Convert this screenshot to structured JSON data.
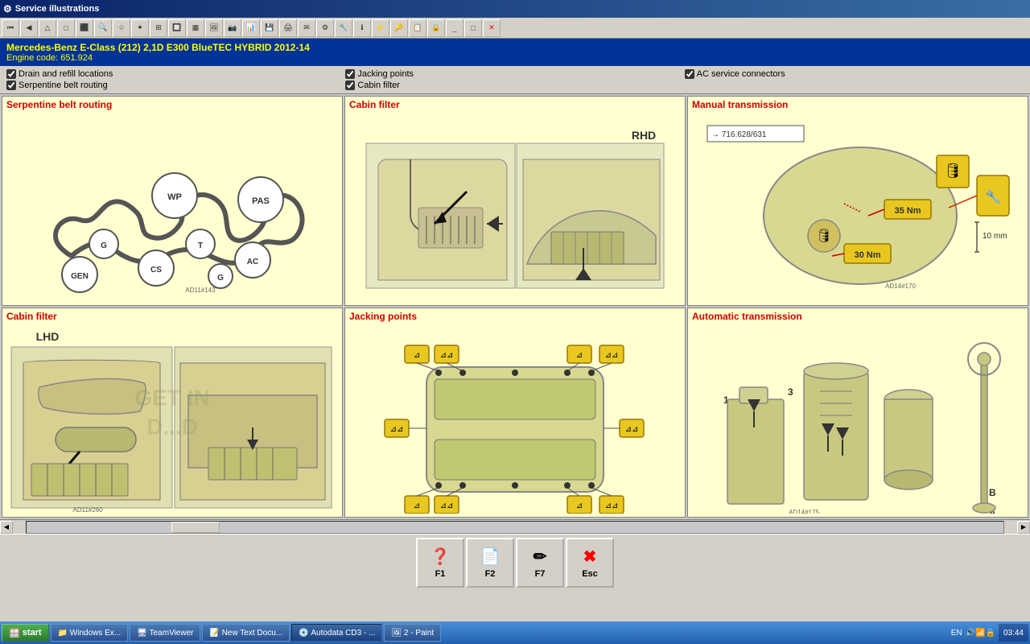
{
  "titlebar": {
    "icon": "⚙",
    "title": "Service illustrations"
  },
  "header": {
    "car_title": "Mercedes-Benz  E-Class (212) 2,1D E300 BlueTEC HYBRID 2012-14",
    "engine_code": "Engine code: 651.924"
  },
  "checkboxes": {
    "col1": [
      {
        "label": "Drain and refill locations",
        "checked": true
      },
      {
        "label": "Serpentine belt routing",
        "checked": true
      }
    ],
    "col2": [
      {
        "label": "Jacking points",
        "checked": true
      },
      {
        "label": "Cabin filter",
        "checked": true
      }
    ],
    "col3": [
      {
        "label": "AC service connectors",
        "checked": true
      }
    ]
  },
  "panels": [
    {
      "id": "serpentine",
      "title": "Serpentine belt routing",
      "row": 1,
      "col": 1
    },
    {
      "id": "cabin-filter-rhd",
      "title": "Cabin filter",
      "row": 1,
      "col": 2
    },
    {
      "id": "manual-transmission",
      "title": "Manual transmission",
      "row": 1,
      "col": 3
    },
    {
      "id": "cabin-filter-lhd",
      "title": "Cabin filter",
      "row": 2,
      "col": 1
    },
    {
      "id": "jacking-points",
      "title": "Jacking points",
      "row": 2,
      "col": 2
    },
    {
      "id": "automatic-transmission",
      "title": "Automatic transmission",
      "row": 2,
      "col": 3
    }
  ],
  "function_buttons": [
    {
      "key": "F1",
      "icon": "❓"
    },
    {
      "key": "F2",
      "icon": "📄"
    },
    {
      "key": "F7",
      "icon": "✏"
    },
    {
      "key": "Esc",
      "icon": "✖"
    }
  ],
  "taskbar": {
    "start_label": "start",
    "items": [
      {
        "label": "Windows Ex...",
        "icon": "📁"
      },
      {
        "label": "TeamViewer",
        "icon": "🖥"
      },
      {
        "label": "New Text Docu...",
        "icon": "📝"
      },
      {
        "label": "Autodata CD3 - ...",
        "icon": "💿",
        "active": true
      },
      {
        "label": "2 - Paint",
        "icon": "🖼"
      }
    ],
    "lang": "EN",
    "time": "03:44"
  }
}
